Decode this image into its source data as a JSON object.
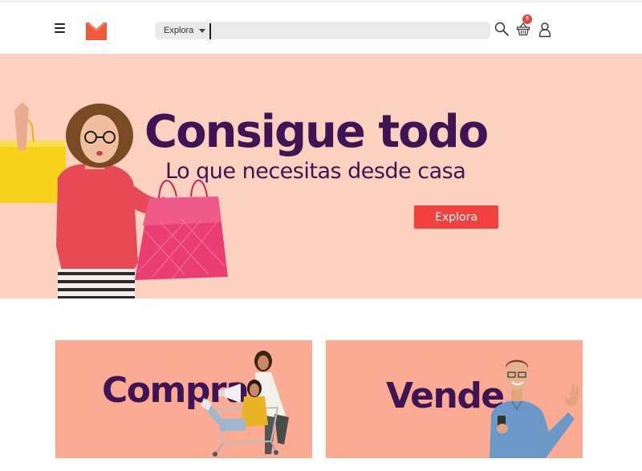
{
  "header": {
    "search": {
      "category_label": "Explora",
      "placeholder": ""
    },
    "cart": {
      "count": "0"
    }
  },
  "hero": {
    "title": "Consigue todo",
    "subtitle": "Lo que necesitas desde casa",
    "button_label": "Explora"
  },
  "cards": {
    "buy": {
      "label": "Compra"
    },
    "sell": {
      "label": "Vende"
    }
  },
  "colors": {
    "brand_orange": "#ee5a3a",
    "brand_purple": "#3e1453",
    "accent_red": "#f2403f",
    "hero_bg": "#fdd1c0",
    "card_bg": "#fbaa93"
  },
  "icons": [
    "menu-icon",
    "logo-m",
    "caret-down-icon",
    "search-icon",
    "basket-icon",
    "user-icon"
  ]
}
